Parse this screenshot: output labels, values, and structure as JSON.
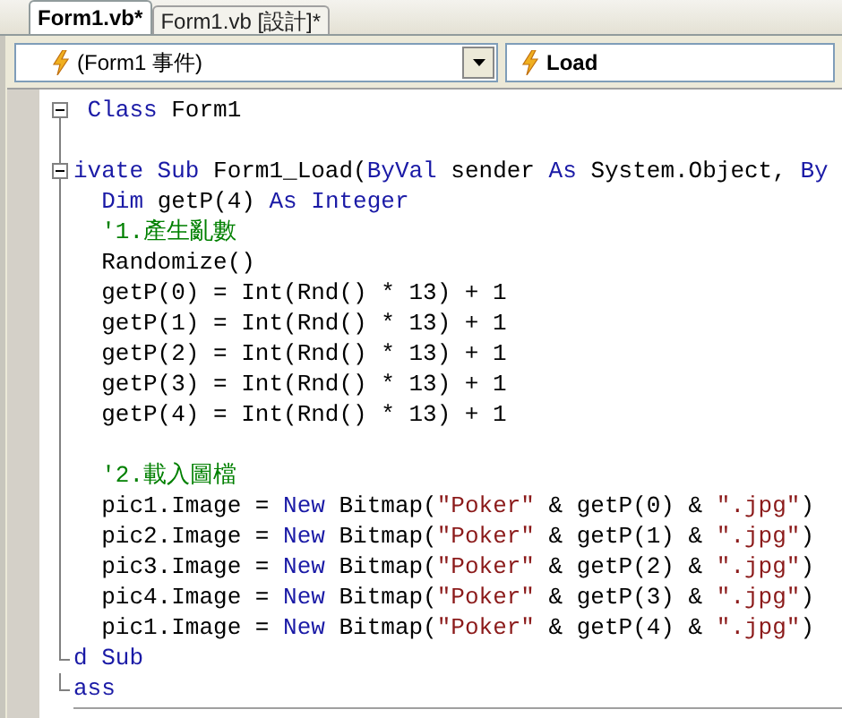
{
  "tabs": [
    {
      "label": "Form1.vb*",
      "selected": true
    },
    {
      "label": "Form1.vb [設計]*",
      "selected": false
    }
  ],
  "object_dropdown": {
    "value": "(Form1 事件)"
  },
  "event_dropdown": {
    "value": "Load"
  },
  "code_lines": [
    {
      "kind": "fold_start",
      "tokens": [
        {
          "kind": "keyword",
          "text": " Class"
        },
        {
          "kind": "plain",
          "text": " Form1"
        }
      ]
    },
    {
      "kind": "guide"
    },
    {
      "kind": "fold_start",
      "tokens": [
        {
          "kind": "keyword",
          "text": "ivate Sub"
        },
        {
          "kind": "plain",
          "text": " Form1_Load("
        },
        {
          "kind": "keyword",
          "text": "ByVal"
        },
        {
          "kind": "plain",
          "text": " sender "
        },
        {
          "kind": "keyword",
          "text": "As"
        },
        {
          "kind": "plain",
          "text": " System.Object, "
        },
        {
          "kind": "keyword",
          "text": "By"
        }
      ]
    },
    {
      "kind": "guide",
      "tokens": [
        {
          "kind": "keyword",
          "text": "  Dim"
        },
        {
          "kind": "plain",
          "text": " getP(4) "
        },
        {
          "kind": "keyword",
          "text": "As Integer"
        }
      ]
    },
    {
      "kind": "guide",
      "tokens": [
        {
          "kind": "comment",
          "text": "  '1.產生亂數"
        }
      ]
    },
    {
      "kind": "guide",
      "tokens": [
        {
          "kind": "plain",
          "text": "  Randomize()"
        }
      ]
    },
    {
      "kind": "guide",
      "tokens": [
        {
          "kind": "plain",
          "text": "  getP(0) = Int(Rnd() * 13) + 1"
        }
      ]
    },
    {
      "kind": "guide",
      "tokens": [
        {
          "kind": "plain",
          "text": "  getP(1) = Int(Rnd() * 13) + 1"
        }
      ]
    },
    {
      "kind": "guide",
      "tokens": [
        {
          "kind": "plain",
          "text": "  getP(2) = Int(Rnd() * 13) + 1"
        }
      ]
    },
    {
      "kind": "guide",
      "tokens": [
        {
          "kind": "plain",
          "text": "  getP(3) = Int(Rnd() * 13) + 1"
        }
      ]
    },
    {
      "kind": "guide",
      "tokens": [
        {
          "kind": "plain",
          "text": "  getP(4) = Int(Rnd() * 13) + 1"
        }
      ]
    },
    {
      "kind": "guide"
    },
    {
      "kind": "guide",
      "tokens": [
        {
          "kind": "comment",
          "text": "  '2.載入圖檔"
        }
      ]
    },
    {
      "kind": "guide",
      "tokens": [
        {
          "kind": "plain",
          "text": "  pic1.Image = "
        },
        {
          "kind": "keyword",
          "text": "New"
        },
        {
          "kind": "plain",
          "text": " Bitmap("
        },
        {
          "kind": "string",
          "text": "\"Poker\""
        },
        {
          "kind": "plain",
          "text": " & getP(0) & "
        },
        {
          "kind": "string",
          "text": "\".jpg\""
        },
        {
          "kind": "plain",
          "text": ")"
        }
      ]
    },
    {
      "kind": "guide",
      "tokens": [
        {
          "kind": "plain",
          "text": "  pic2.Image = "
        },
        {
          "kind": "keyword",
          "text": "New"
        },
        {
          "kind": "plain",
          "text": " Bitmap("
        },
        {
          "kind": "string",
          "text": "\"Poker\""
        },
        {
          "kind": "plain",
          "text": " & getP(1) & "
        },
        {
          "kind": "string",
          "text": "\".jpg\""
        },
        {
          "kind": "plain",
          "text": ")"
        }
      ]
    },
    {
      "kind": "guide",
      "tokens": [
        {
          "kind": "plain",
          "text": "  pic3.Image = "
        },
        {
          "kind": "keyword",
          "text": "New"
        },
        {
          "kind": "plain",
          "text": " Bitmap("
        },
        {
          "kind": "string",
          "text": "\"Poker\""
        },
        {
          "kind": "plain",
          "text": " & getP(2) & "
        },
        {
          "kind": "string",
          "text": "\".jpg\""
        },
        {
          "kind": "plain",
          "text": ")"
        }
      ]
    },
    {
      "kind": "guide",
      "tokens": [
        {
          "kind": "plain",
          "text": "  pic4.Image = "
        },
        {
          "kind": "keyword",
          "text": "New"
        },
        {
          "kind": "plain",
          "text": " Bitmap("
        },
        {
          "kind": "string",
          "text": "\"Poker\""
        },
        {
          "kind": "plain",
          "text": " & getP(3) & "
        },
        {
          "kind": "string",
          "text": "\".jpg\""
        },
        {
          "kind": "plain",
          "text": ")"
        }
      ]
    },
    {
      "kind": "guide",
      "tokens": [
        {
          "kind": "plain",
          "text": "  pic1.Image = "
        },
        {
          "kind": "keyword",
          "text": "New"
        },
        {
          "kind": "plain",
          "text": " Bitmap("
        },
        {
          "kind": "string",
          "text": "\"Poker\""
        },
        {
          "kind": "plain",
          "text": " & getP(4) & "
        },
        {
          "kind": "string",
          "text": "\".jpg\""
        },
        {
          "kind": "plain",
          "text": ")"
        }
      ]
    },
    {
      "kind": "fold_end",
      "tokens": [
        {
          "kind": "keyword",
          "text": "d Sub"
        }
      ]
    },
    {
      "kind": "fold_end",
      "tokens": [
        {
          "kind": "keyword",
          "text": "ass"
        }
      ]
    }
  ]
}
